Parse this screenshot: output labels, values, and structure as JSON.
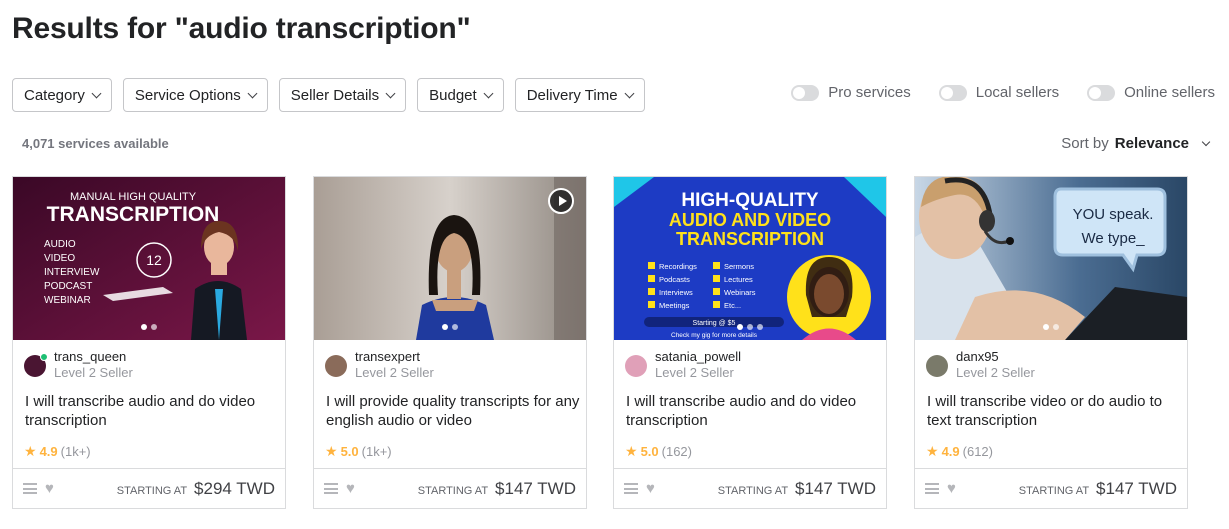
{
  "page": {
    "title": "Results for \"audio transcription\""
  },
  "filters": [
    "Category",
    "Service Options",
    "Seller Details",
    "Budget",
    "Delivery Time"
  ],
  "toggles": [
    "Pro services",
    "Local sellers",
    "Online sellers"
  ],
  "results": {
    "count_text": "4,071 services available",
    "sort_label": "Sort by",
    "sort_value": "Relevance"
  },
  "price_label": "STARTING AT",
  "gigs": [
    {
      "seller": "trans_queen",
      "level": "Level 2 Seller",
      "online": true,
      "title": "I will transcribe audio and do video transcription",
      "rating": "4.9",
      "reviews": "(1k+)",
      "price": "$294 TWD",
      "thumb": {
        "lines": [
          "MANUAL HIGH QUALITY",
          "TRANSCRIPTION",
          "AUDIO",
          "VIDEO",
          "INTERVIEW",
          "PODCAST",
          "WEBINAR"
        ],
        "badge": "12"
      }
    },
    {
      "seller": "transexpert",
      "level": "Level 2 Seller",
      "title": "I will provide quality transcripts for any english audio or video",
      "rating": "5.0",
      "reviews": "(1k+)",
      "price": "$147 TWD"
    },
    {
      "seller": "satania_powell",
      "level": "Level 2 Seller",
      "title": "I will transcribe audio and do video transcription",
      "rating": "5.0",
      "reviews": "(162)",
      "price": "$147 TWD",
      "thumb": {
        "lines": [
          "HIGH-QUALITY",
          "AUDIO AND VIDEO",
          "TRANSCRIPTION"
        ],
        "items": [
          "Recordings",
          "Sermons",
          "Podcasts",
          "Lectures",
          "Interviews",
          "Webinars",
          "Meetings",
          "Etc..."
        ],
        "footer": [
          "Starting @ $5",
          "Check my gig for more details"
        ]
      }
    },
    {
      "seller": "danx95",
      "level": "Level 2 Seller",
      "title": "I will transcribe video or do audio to text transcription",
      "rating": "4.9",
      "reviews": "(612)",
      "price": "$147 TWD",
      "thumb": {
        "bubble": [
          "YOU speak.",
          "We type_"
        ]
      }
    }
  ],
  "icons": [
    "chevron-down-icon",
    "play-icon",
    "star-icon",
    "menu-icon",
    "heart-icon"
  ],
  "colors": {
    "star": "#ffb33e",
    "online": "#1dbf73",
    "thumb3_bg": "#1d3bc4",
    "thumb3_accent": "#ffe11a"
  }
}
